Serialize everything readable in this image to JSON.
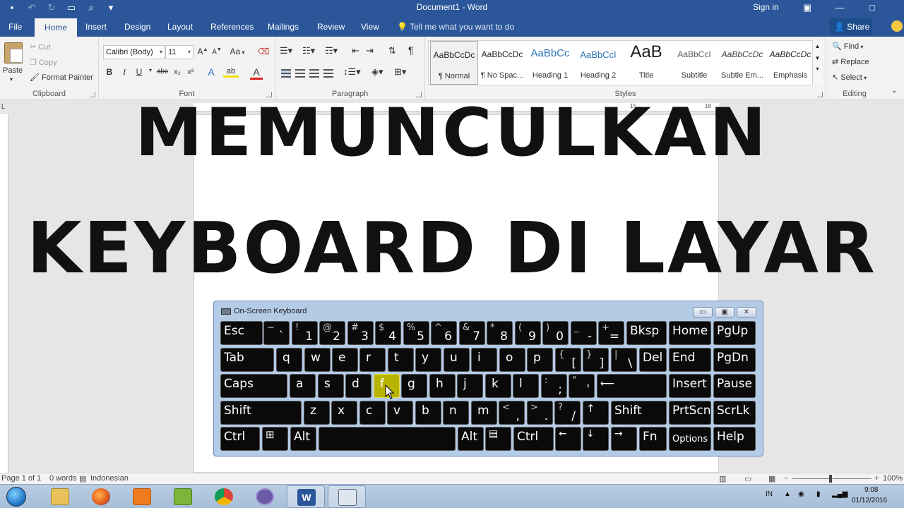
{
  "window": {
    "title": "Document1 - Word",
    "signin": "Sign in"
  },
  "tabs": {
    "file": "File",
    "home": "Home",
    "insert": "Insert",
    "design": "Design",
    "layout": "Layout",
    "references": "References",
    "mailings": "Mailings",
    "review": "Review",
    "view": "View"
  },
  "tellme": "Tell me what you want to do",
  "share": "Share",
  "clipboard": {
    "paste": "Paste",
    "cut": "Cut",
    "copy": "Copy",
    "format_painter": "Format Painter",
    "label": "Clipboard"
  },
  "font": {
    "name": "Calibri (Body)",
    "size": "11",
    "label": "Font",
    "bold": "B",
    "italic": "I",
    "underline": "U",
    "strike": "abc",
    "sub": "x₂",
    "sup": "x²",
    "grow": "A",
    "shrink": "A",
    "case": "Aa",
    "effects": "A",
    "highlight": "ab",
    "color": "A"
  },
  "paragraph": {
    "label": "Paragraph",
    "pilcrow": "¶"
  },
  "styles": {
    "label": "Styles",
    "items": [
      {
        "preview": "AaBbCcDc",
        "name": "¶ Normal"
      },
      {
        "preview": "AaBbCcDc",
        "name": "¶ No Spac..."
      },
      {
        "preview": "AaBbCc",
        "name": "Heading 1"
      },
      {
        "preview": "AaBbCcI",
        "name": "Heading 2"
      },
      {
        "preview": "AaB",
        "name": "Title"
      },
      {
        "preview": "AaBbCcI",
        "name": "Subtitle"
      },
      {
        "preview": "AaBbCcDc",
        "name": "Subtle Em..."
      },
      {
        "preview": "AaBbCcDc",
        "name": "Emphasis"
      }
    ]
  },
  "editing": {
    "find": "Find",
    "replace": "Replace",
    "select": "Select",
    "label": "Editing"
  },
  "ruler": {
    "corner": "L",
    "n15": "15",
    "n18": "18"
  },
  "banner": {
    "line1": "MEMUNCULKAN",
    "line2": "KEYBOARD DI LAYAR"
  },
  "osk": {
    "title": "On-Screen Keyboard",
    "keys": {
      "esc": "Esc",
      "tilde_up": "~",
      "tilde_low": "`",
      "n1_up": "!",
      "n1": "1",
      "n2_up": "@",
      "n2": "2",
      "n3_up": "#",
      "n3": "3",
      "n4_up": "$",
      "n4": "4",
      "n5_up": "%",
      "n5": "5",
      "n6_up": "^",
      "n6": "6",
      "n7_up": "&",
      "n7": "7",
      "n8_up": "*",
      "n8": "8",
      "n9_up": "(",
      "n9": "9",
      "n0_up": ")",
      "n0": "0",
      "minus_up": "_",
      "minus": "-",
      "plus_up": "+",
      "plus": "=",
      "bksp": "Bksp",
      "home": "Home",
      "pgup": "PgUp",
      "tab": "Tab",
      "q": "q",
      "w": "w",
      "e": "e",
      "r": "r",
      "t": "t",
      "y": "y",
      "u": "u",
      "i": "i",
      "o": "o",
      "p": "p",
      "lbrace_up": "{",
      "lbrace": "[",
      "rbrace_up": "}",
      "rbrace": "]",
      "pipe_up": "|",
      "pipe": "\\",
      "del": "Del",
      "end": "End",
      "pgdn": "PgDn",
      "caps": "Caps",
      "a": "a",
      "s": "s",
      "d": "d",
      "f": "f",
      "g": "g",
      "h": "h",
      "j": "j",
      "k": "k",
      "l": "l",
      "colon_up": ":",
      "colon": ";",
      "quote_up": "\"",
      "quote": "'",
      "enter": "⟵",
      "insert": "Insert",
      "pause": "Pause",
      "shift": "Shift",
      "z": "z",
      "x": "x",
      "c": "c",
      "v": "v",
      "b": "b",
      "n": "n",
      "m": "m",
      "lt_up": "<",
      "lt": ",",
      "gt_up": ">",
      "gt": ".",
      "q_up": "?",
      "slash": "/",
      "up": "↑",
      "shift_r": "Shift",
      "prtscn": "PrtScn",
      "scrlk": "ScrLk",
      "ctrl": "Ctrl",
      "win": "⊞",
      "alt": "Alt",
      "alt_r": "Alt",
      "menu": "▤",
      "ctrl_r": "Ctrl",
      "left": "←",
      "down": "↓",
      "right": "→",
      "fn": "Fn",
      "options": "Options",
      "help": "Help"
    }
  },
  "status": {
    "page": "Page 1 of 1",
    "words": "0 words",
    "lang": "Indonesian",
    "zoom": "100%"
  },
  "taskbar": {
    "lang": "IN",
    "time": "9:08",
    "date": "01/12/2016"
  }
}
